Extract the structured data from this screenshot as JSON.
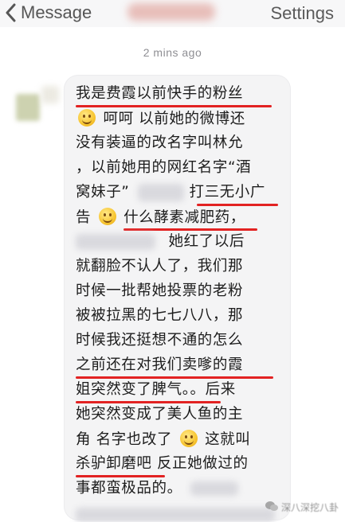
{
  "nav": {
    "back_label": "Message",
    "settings_label": "Settings"
  },
  "timestamp": "2 mins ago",
  "message": {
    "lines": [
      "我是费霞以前快手的粉丝",
      "呵呵 以前她的微博还",
      "没有装逼的改名字叫林允",
      "，以前她用的网红名字“酒",
      "窝妹子”",
      "打三无小广",
      "告",
      "什么酵素减肥药，",
      "她红了以后",
      "就翻脸不认人了，我们那",
      "时候一批帮她投票的老粉",
      "被被拉黑的七七八八，那",
      "时候我还挺想不通的怎么",
      "之前还在对我们卖嗲的霞",
      "姐突然变了脾气。。后来",
      "她突然变成了美人鱼的主",
      "角 名字也改了",
      "这就叫",
      "杀驴卸磨吧 反正她做过的",
      "事都蛮极品的。"
    ]
  },
  "watermark": "深八深挖八卦",
  "colors": {
    "underline": "#e22222",
    "bubble": "#f4f4f5",
    "nav_text": "#565656"
  }
}
